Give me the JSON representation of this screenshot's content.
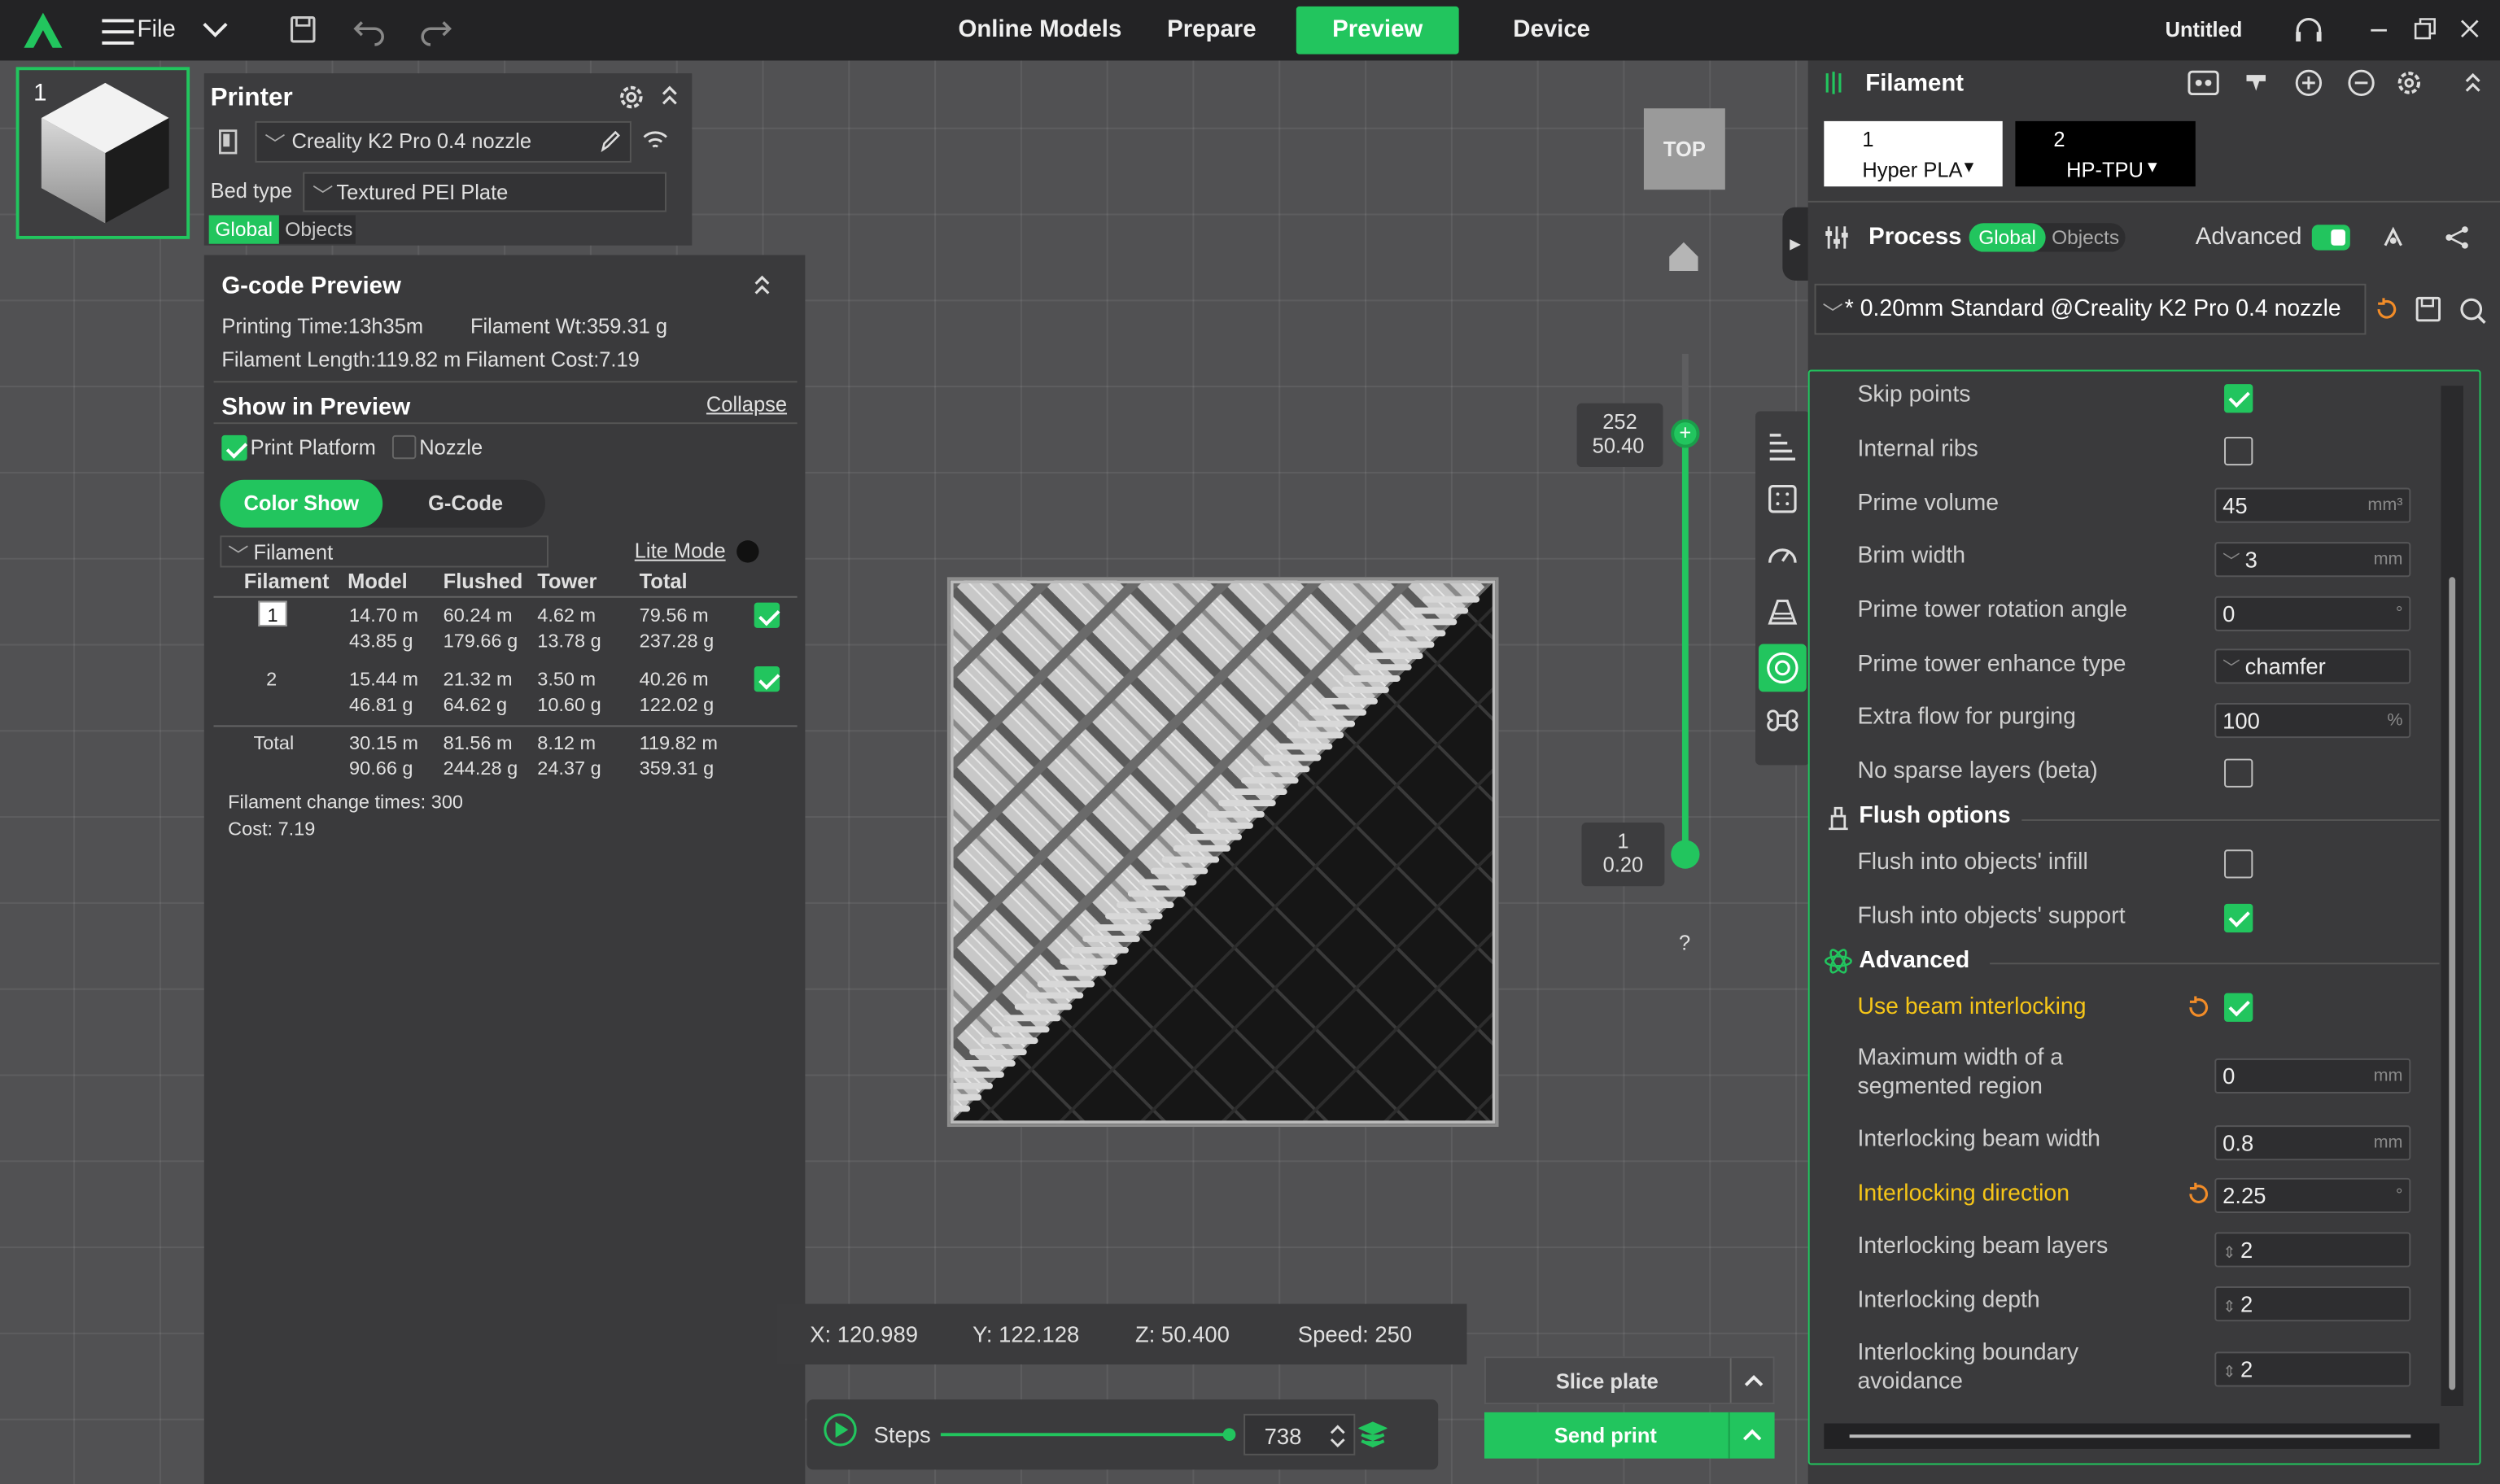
{
  "topbar": {
    "file_label": "File",
    "tabs": [
      "Online Models",
      "Prepare",
      "Preview",
      "Device"
    ],
    "active_tab": "Preview",
    "project_title": "Untitled"
  },
  "plate": {
    "number": "1"
  },
  "printer": {
    "title": "Printer",
    "name": "Creality K2 Pro 0.4 nozzle",
    "bed_type_label": "Bed type",
    "bed_type": "Textured PEI Plate",
    "global_label": "Global",
    "objects_label": "Objects"
  },
  "gcode": {
    "title": "G-code Preview",
    "printing_time": "Printing Time:13h35m",
    "filament_wt": "Filament Wt:359.31 g",
    "filament_length": "Filament Length:119.82 m",
    "filament_cost": "Filament Cost:7.19",
    "show_in_preview": "Show in Preview",
    "collapse": "Collapse",
    "print_platform": "Print Platform",
    "nozzle": "Nozzle",
    "color_show": "Color Show",
    "gcode_tab": "G-Code",
    "view_select": "Filament",
    "lite_mode": "Lite Mode",
    "headers": [
      "Filament",
      "Model",
      "Flushed",
      "Tower",
      "Total"
    ],
    "rows": [
      {
        "id": "1",
        "model": [
          "14.70 m",
          "43.85 g"
        ],
        "flushed": [
          "60.24 m",
          "179.66 g"
        ],
        "tower": [
          "4.62 m",
          "13.78 g"
        ],
        "total": [
          "79.56 m",
          "237.28 g"
        ]
      },
      {
        "id": "2",
        "model": [
          "15.44 m",
          "46.81 g"
        ],
        "flushed": [
          "21.32 m",
          "64.62 g"
        ],
        "tower": [
          "3.50 m",
          "10.60 g"
        ],
        "total": [
          "40.26 m",
          "122.02 g"
        ]
      }
    ],
    "total_row": {
      "label": "Total",
      "model": [
        "30.15 m",
        "90.66 g"
      ],
      "flushed": [
        "81.56 m",
        "244.28 g"
      ],
      "tower": [
        "8.12 m",
        "24.37 g"
      ],
      "total": [
        "119.82 m",
        "359.31 g"
      ]
    },
    "change_times": "Filament change times: 300",
    "cost": "Cost: 7.19"
  },
  "viewport": {
    "top_button": "TOP",
    "slider_top_layer": "252",
    "slider_top_height": "50.40",
    "slider_bottom_layer": "1",
    "slider_bottom_height": "0.20",
    "help": "?",
    "coords": {
      "x": "X: 120.989",
      "y": "Y: 122.128",
      "z": "Z: 50.400",
      "speed": "Speed: 250"
    },
    "steps_label": "Steps",
    "steps_value": "738",
    "slice_plate": "Slice plate",
    "send_print": "Send print"
  },
  "filament_panel": {
    "title": "Filament",
    "slots": [
      {
        "index": "1",
        "name": "Hyper PLA"
      },
      {
        "index": "2",
        "name": "HP-TPU"
      }
    ]
  },
  "process": {
    "title": "Process",
    "global_label": "Global",
    "objects_label": "Objects",
    "advanced_label": "Advanced",
    "preset": "* 0.20mm Standard @Creality K2 Pro 0.4 nozzle",
    "settings": [
      {
        "label": "Skip points",
        "type": "check",
        "checked": true
      },
      {
        "label": "Internal ribs",
        "type": "check",
        "checked": false
      },
      {
        "label": "Prime volume",
        "type": "input",
        "value": "45",
        "unit": "mm³"
      },
      {
        "label": "Brim width",
        "type": "spin",
        "value": "3",
        "unit": "mm"
      },
      {
        "label": "Prime tower rotation angle",
        "type": "input",
        "value": "0",
        "unit": "°"
      },
      {
        "label": "Prime tower enhance type",
        "type": "select",
        "value": "chamfer"
      },
      {
        "label": "Extra flow for purging",
        "type": "input",
        "value": "100",
        "unit": "%"
      },
      {
        "label": "No sparse layers (beta)",
        "type": "check",
        "checked": false
      }
    ],
    "flush_section": "Flush options",
    "flush_settings": [
      {
        "label": "Flush into objects' infill",
        "checked": false
      },
      {
        "label": "Flush into objects' support",
        "checked": true
      }
    ],
    "advanced_section": "Advanced",
    "advanced_settings": {
      "beam_interlocking": "Use beam interlocking",
      "max_width": "Maximum width of a",
      "max_width2": "segmented region",
      "max_width_value": "0",
      "beam_width": "Interlocking beam width",
      "beam_width_value": "0.8",
      "direction": "Interlocking direction",
      "direction_value": "2.25",
      "beam_layers": "Interlocking beam layers",
      "beam_layers_value": "2",
      "depth": "Interlocking depth",
      "depth_value": "2",
      "boundary": "Interlocking boundary",
      "boundary2": "avoidance",
      "boundary_value": "2",
      "unit_mm": "mm",
      "unit_deg": "°"
    }
  },
  "colors": {
    "accent": "#22c55e",
    "modified": "#f5c518",
    "reset": "#f28c28"
  }
}
